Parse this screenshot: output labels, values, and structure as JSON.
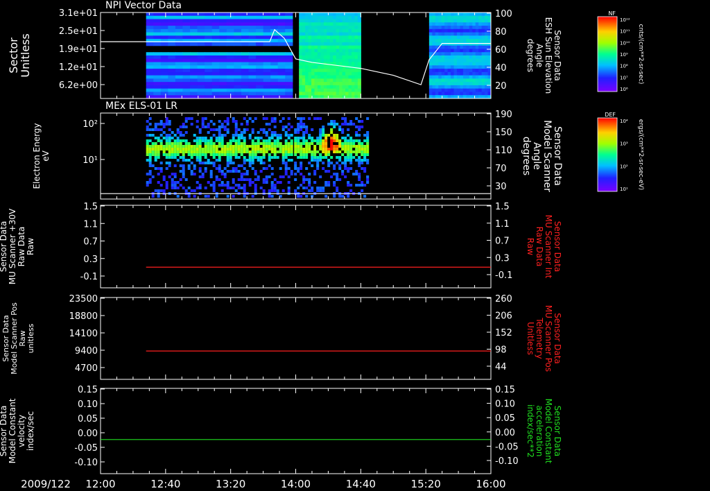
{
  "date_label": "2009/122",
  "x_ticks": [
    "12:00",
    "12:40",
    "13:20",
    "14:00",
    "14:40",
    "15:20",
    "16:00"
  ],
  "colorbars": [
    {
      "title": "NF",
      "unit": "cnts/(cm**2-sr-sec)",
      "ticks": [
        "10¹²",
        "10¹¹",
        "10¹⁰",
        "10⁹",
        "10⁸",
        "10⁷",
        "10⁶"
      ]
    },
    {
      "title": "DEF",
      "unit": "ergs/(cm**2-sr-sec-eV)",
      "ticks": [
        "10⁴",
        "10³",
        "10²",
        "10¹"
      ]
    }
  ],
  "chart_data": [
    {
      "type": "heatmap",
      "title": "NPI Vector Data",
      "ylabel": "Sector\nUnitless",
      "y_ticks": [
        "3.1e+01",
        "2.5e+01",
        "1.9e+01",
        "1.2e+01",
        "6.2e+00"
      ],
      "right_ylabel": "Sensor Data\nESH Sun Elevation\nAngle\ndegrees",
      "right_ticks": [
        "100",
        "80",
        "60",
        "40",
        "20"
      ],
      "right_ylim": [
        0,
        100
      ],
      "color_scale": "NF",
      "data_intervals": [
        [
          "12:28",
          "13:58"
        ],
        [
          "14:02",
          "14:40"
        ],
        [
          "15:22",
          "16:00"
        ]
      ],
      "overlay_line": {
        "name": "ESH Sun Elevation Angle",
        "x": [
          "12:00",
          "12:28",
          "13:44",
          "13:47",
          "13:53",
          "14:00",
          "14:10",
          "14:40",
          "15:00",
          "15:17",
          "15:22",
          "15:30",
          "16:00"
        ],
        "y": [
          66,
          66,
          66,
          80,
          70,
          46,
          42,
          35,
          27,
          16,
          45,
          64,
          64
        ]
      }
    },
    {
      "type": "heatmap",
      "title": "MEx ELS-01 LR",
      "ylabel": "Electron Energy\neV",
      "y_ticks": [
        "10²",
        "10¹"
      ],
      "right_ylabel": "Sensor Data\nModel Scanner\nAngle\ndegrees",
      "right_ticks": [
        "190",
        "150",
        "110",
        "70",
        "30"
      ],
      "right_ylim": [
        0,
        190
      ],
      "color_scale": "DEF",
      "data_intervals": [
        [
          "12:28",
          "13:57"
        ],
        [
          "13:59",
          "14:45"
        ]
      ],
      "overlay_line": {
        "name": "Model Scanner Angle",
        "x": [
          "12:00",
          "16:00"
        ],
        "y": [
          12,
          12
        ]
      }
    },
    {
      "type": "line",
      "ylabel": "Sensor Data\nMU Scanner +30V\nRaw Data\nRaw",
      "y_ticks": [
        "1.5",
        "1.1",
        "0.7",
        "0.3",
        "-0.1"
      ],
      "ylim": [
        -0.5,
        1.5
      ],
      "right_ylabel": "Sensor Data\nMU Scanner Int\nRaw Data\nRaw",
      "right_ticks": [
        "1.5",
        "1.1",
        "0.7",
        "0.3",
        "-0.1"
      ],
      "right_ylim": [
        -0.5,
        1.5
      ],
      "series": [
        {
          "x": [
            "12:28",
            "16:00"
          ],
          "y": [
            0.0,
            0.0
          ],
          "color": "#ff2020",
          "axis": "right"
        }
      ]
    },
    {
      "type": "line",
      "ylabel": "Sensor Data\nModel Scanner Pos\nRaw\nunitless",
      "y_ticks": [
        "23500",
        "18800",
        "14100",
        "9400",
        "4700"
      ],
      "ylim": [
        0,
        23500
      ],
      "right_ylabel": "Sensor Data\nMU Scanner Pos\nTelemetry\nUnitless",
      "right_ticks": [
        "260",
        "206",
        "152",
        "98",
        "44"
      ],
      "right_ylim": [
        0,
        260
      ],
      "series": [
        {
          "x": [
            "12:28",
            "16:00"
          ],
          "y": [
            90,
            90
          ],
          "color": "#ff2020",
          "axis": "right"
        }
      ]
    },
    {
      "type": "line",
      "ylabel": "Sensor Data\nModel Constant\nvelocity\nindex/sec",
      "y_ticks": [
        "0.15",
        "0.10",
        "0.05",
        "0.00",
        "-0.05",
        "-0.10"
      ],
      "ylim": [
        -0.1,
        0.15
      ],
      "right_ylabel": "Sensor Data\nModel Constant\nacceleration\nindex/sec**2",
      "right_ticks": [
        "0.15",
        "0.10",
        "0.05",
        "0.00",
        "-0.05",
        "-0.10"
      ],
      "right_ylim": [
        -0.1,
        0.15
      ],
      "series": [
        {
          "x": [
            "12:00",
            "16:00"
          ],
          "y": [
            0.0,
            0.0
          ],
          "color": "#20e020",
          "axis": "left"
        }
      ]
    }
  ]
}
